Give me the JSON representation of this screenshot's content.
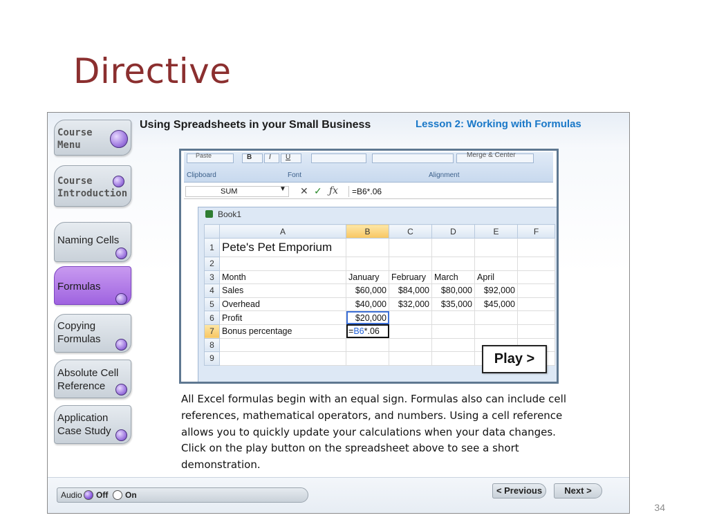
{
  "slide": {
    "title": "Directive",
    "number": "34"
  },
  "course": {
    "title": "Using Spreadsheets in your Small Business",
    "lesson": "Lesson 2: Working with Formulas"
  },
  "nav": [
    {
      "label_line1": "Course",
      "label_line2": "Menu"
    },
    {
      "label_line1": "Course",
      "label_line2": "Introduction"
    },
    {
      "label_line1": "Naming Cells",
      "label_line2": ""
    },
    {
      "label_line1": "Formulas",
      "label_line2": "",
      "active": true
    },
    {
      "label_line1": "Copying",
      "label_line2": "Formulas"
    },
    {
      "label_line1": "Absolute Cell",
      "label_line2": "Reference"
    },
    {
      "label_line1": "Application",
      "label_line2": "Case Study"
    }
  ],
  "excel": {
    "ribbon_groups": [
      "Clipboard",
      "Font",
      "Alignment"
    ],
    "ribbon_items": [
      "Paste",
      "B",
      "I",
      "U",
      "Merge & Center"
    ],
    "name_box": "SUM",
    "formula": "=B6*.06",
    "book_title": "Book1",
    "columns": [
      "A",
      "B",
      "C",
      "D",
      "E",
      "F"
    ],
    "rows": [
      "1",
      "2",
      "3",
      "4",
      "5",
      "6",
      "7",
      "8",
      "9"
    ],
    "cells": {
      "r1": {
        "a": "Pete's Pet Emporium"
      },
      "r3": {
        "a": "Month",
        "b": "January",
        "c": "February",
        "d": "March",
        "e": "April"
      },
      "r4": {
        "a": "Sales",
        "b": "$60,000",
        "c": "$84,000",
        "d": "$80,000",
        "e": "$92,000"
      },
      "r5": {
        "a": "Overhead",
        "b": "$40,000",
        "c": "$32,000",
        "d": "$35,000",
        "e": "$45,000"
      },
      "r6": {
        "a": "Profit",
        "b": "$20,000"
      },
      "r7": {
        "a": "Bonus percentage",
        "b_prefix": "=",
        "b_ref": "B6",
        "b_suffix": "*.06"
      }
    }
  },
  "play_button": "Play >",
  "description": "All Excel formulas begin with an equal sign.  Formulas also can include cell references, mathematical operators, and numbers. Using a cell reference allows you to quickly update your calculations when your data changes. Click on the play button on the spreadsheet above to see a short demonstration.",
  "bottom": {
    "audio_label": "Audio",
    "off_label": "Off",
    "on_label": "On",
    "previous": "< Previous",
    "next": "Next >"
  },
  "colors": {
    "title": "#8b2f2f",
    "lesson": "#1a78c8",
    "active_tab": "#9f63e0"
  }
}
